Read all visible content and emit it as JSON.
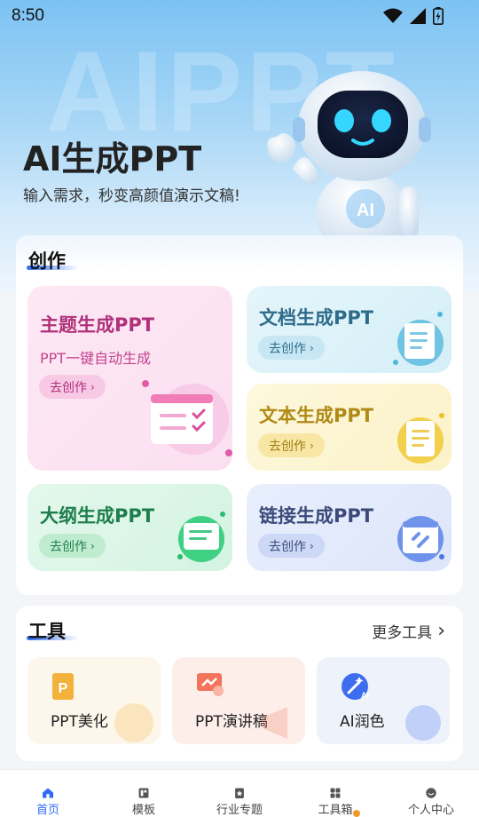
{
  "status_bar": {
    "time": "8:50"
  },
  "hero": {
    "watermark": "AIPPT",
    "title": "AI生成PPT",
    "subtitle": "输入需求，秒变高颜值演示文稿!",
    "robot_badge": "AI"
  },
  "create_section": {
    "title": "创作",
    "features": [
      {
        "title": "主题生成PPT",
        "subtitle": "PPT一键自动生成",
        "button": "去创作",
        "accent": "#b03079"
      },
      {
        "title": "文档生成PPT",
        "button": "去创作",
        "accent": "#2e6c8a"
      },
      {
        "title": "文本生成PPT",
        "button": "去创作",
        "accent": "#b08a16"
      },
      {
        "title": "大纲生成PPT",
        "button": "去创作",
        "accent": "#1e7e4d"
      },
      {
        "title": "链接生成PPT",
        "button": "去创作",
        "accent": "#3c4a7a"
      }
    ]
  },
  "tools_section": {
    "title": "工具",
    "more": "更多工具",
    "items": [
      {
        "label": "PPT美化",
        "icon": "ppt-icon"
      },
      {
        "label": "PPT演讲稿",
        "icon": "presentation-icon"
      },
      {
        "label": "AI润色",
        "icon": "magic-wand-icon"
      }
    ]
  },
  "bottom_nav": [
    {
      "label": "首页",
      "icon": "home-icon",
      "active": true
    },
    {
      "label": "模板",
      "icon": "template-icon"
    },
    {
      "label": "行业专题",
      "icon": "bookmark-icon"
    },
    {
      "label": "工具箱",
      "icon": "grid-icon"
    },
    {
      "label": "个人中心",
      "icon": "smiley-icon"
    }
  ],
  "colors": {
    "primary": "#2f6bf6",
    "hero_top": "#7cc2f3",
    "page_bg": "#f3f5f9"
  }
}
